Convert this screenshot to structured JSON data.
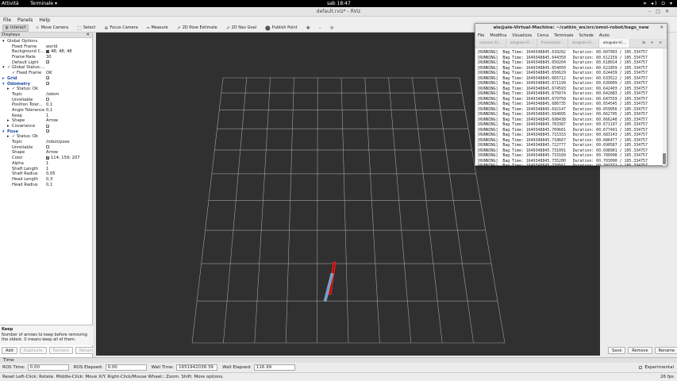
{
  "topbar": {
    "activities": "Attività",
    "app": "Terminale ▾",
    "clock": "sab 18:47",
    "tray": "⌗ ◂) ⏻ ▾"
  },
  "window": {
    "title": "default.rviz* - RViz"
  },
  "menu": [
    "File",
    "Panels",
    "Help"
  ],
  "toolbar": [
    {
      "icon": "✥",
      "label": "Interact",
      "active": true
    },
    {
      "icon": "✧",
      "label": "Move Camera",
      "active": false
    },
    {
      "icon": "⬚",
      "label": "Select",
      "active": false
    },
    {
      "icon": "⊕",
      "label": "Focus Camera",
      "active": false
    },
    {
      "icon": "═",
      "label": "Measure",
      "active": false
    },
    {
      "icon": "➚",
      "label": "2D Pose Estimate",
      "active": false
    },
    {
      "icon": "➚",
      "label": "2D Nav Goal",
      "active": false
    },
    {
      "icon": "⬤",
      "label": "Publish Point",
      "active": false
    },
    {
      "icon": "✚",
      "label": "",
      "active": false
    },
    {
      "icon": "–",
      "label": "",
      "active": false
    },
    {
      "icon": "✢",
      "label": "",
      "active": false
    }
  ],
  "displays": {
    "title": "Displays",
    "rows": [
      {
        "indent": 1,
        "arrow": "▾",
        "label": "Global Options",
        "value": "",
        "check": null,
        "color": "",
        "blue": false
      },
      {
        "indent": 3,
        "arrow": "",
        "label": "Fixed Frame",
        "value": "world",
        "check": null,
        "color": "",
        "blue": false
      },
      {
        "indent": 3,
        "arrow": "",
        "label": "Background C...",
        "value": "48; 48; 48",
        "check": null,
        "color": "#303030",
        "blue": false
      },
      {
        "indent": 3,
        "arrow": "",
        "label": "Frame Rate",
        "value": "30",
        "check": null,
        "color": "",
        "blue": false
      },
      {
        "indent": 3,
        "arrow": "",
        "label": "Default Light",
        "value": "",
        "check": true,
        "color": "",
        "blue": false
      },
      {
        "indent": 1,
        "arrow": "▾",
        "label": "✓ Global Status:...",
        "value": "",
        "check": null,
        "color": "",
        "blue": false
      },
      {
        "indent": 3,
        "arrow": "",
        "label": "✓ Fixed Frame",
        "value": "OK",
        "check": null,
        "color": "",
        "blue": false
      },
      {
        "indent": 1,
        "arrow": "▸",
        "label": "Grid",
        "value": "",
        "check": true,
        "color": "",
        "blue": true
      },
      {
        "indent": 1,
        "arrow": "▾",
        "label": "Odometry",
        "value": "",
        "check": true,
        "color": "",
        "blue": true
      },
      {
        "indent": 3,
        "arrow": "▸",
        "label": "✓ Status: Ok",
        "value": "",
        "check": null,
        "color": "",
        "blue": false
      },
      {
        "indent": 3,
        "arrow": "",
        "label": "Topic",
        "value": "/odom",
        "check": null,
        "color": "",
        "blue": false
      },
      {
        "indent": 3,
        "arrow": "",
        "label": "Unreliable",
        "value": "",
        "check": false,
        "color": "",
        "blue": false
      },
      {
        "indent": 3,
        "arrow": "",
        "label": "Position Toler...",
        "value": "0,1",
        "check": null,
        "color": "",
        "blue": false
      },
      {
        "indent": 3,
        "arrow": "",
        "label": "Angle Tolerance",
        "value": "0,1",
        "check": null,
        "color": "",
        "blue": false
      },
      {
        "indent": 3,
        "arrow": "",
        "label": "Keep",
        "value": "1",
        "check": null,
        "color": "",
        "blue": false
      },
      {
        "indent": 3,
        "arrow": "▸",
        "label": "Shape",
        "value": "Arrow",
        "check": null,
        "color": "",
        "blue": false
      },
      {
        "indent": 3,
        "arrow": "▸",
        "label": "Covariance",
        "value": "",
        "check": true,
        "color": "",
        "blue": false
      },
      {
        "indent": 1,
        "arrow": "▾",
        "label": "Pose",
        "value": "",
        "check": true,
        "color": "",
        "blue": true
      },
      {
        "indent": 3,
        "arrow": "▸",
        "label": "✓ Status: Ok",
        "value": "",
        "check": null,
        "color": "",
        "blue": false
      },
      {
        "indent": 3,
        "arrow": "",
        "label": "Topic",
        "value": "/robot/pose",
        "check": null,
        "color": "",
        "blue": false
      },
      {
        "indent": 3,
        "arrow": "",
        "label": "Unreliable",
        "value": "",
        "check": false,
        "color": "",
        "blue": false
      },
      {
        "indent": 3,
        "arrow": "",
        "label": "Shape",
        "value": "Arrow",
        "check": null,
        "color": "",
        "blue": false
      },
      {
        "indent": 3,
        "arrow": "",
        "label": "Color",
        "value": "114; 159; 207",
        "check": null,
        "color": "#729fcf",
        "blue": false
      },
      {
        "indent": 3,
        "arrow": "",
        "label": "Alpha",
        "value": "1",
        "check": null,
        "color": "",
        "blue": false
      },
      {
        "indent": 3,
        "arrow": "",
        "label": "Shaft Length",
        "value": "1",
        "check": null,
        "color": "",
        "blue": false
      },
      {
        "indent": 3,
        "arrow": "",
        "label": "Shaft Radius",
        "value": "0,05",
        "check": null,
        "color": "",
        "blue": false
      },
      {
        "indent": 3,
        "arrow": "",
        "label": "Head Length",
        "value": "0,3",
        "check": null,
        "color": "",
        "blue": false
      },
      {
        "indent": 3,
        "arrow": "",
        "label": "Head Radius",
        "value": "0,1",
        "check": null,
        "color": "",
        "blue": false
      }
    ]
  },
  "help": {
    "title": "Keep",
    "text": "Number of arrows to keep before removing the oldest. 0 means keep all of them."
  },
  "panel_buttons": {
    "add": "Add",
    "duplicate": "Duplicate",
    "remove": "Remove",
    "rename": "Rename"
  },
  "views_buttons": {
    "save": "Save",
    "remove": "Remove",
    "rename": "Rename"
  },
  "time": {
    "title": "Time",
    "ros_time_label": "ROS Time:",
    "ros_time": "0.00",
    "ros_elapsed_label": "ROS Elapsed:",
    "ros_elapsed": "0.00",
    "wall_time_label": "Wall Time:",
    "wall_time": "1651942038.39",
    "wall_elapsed_label": "Wall Elapsed:",
    "wall_elapsed": "116.99",
    "experimental": "Experimental"
  },
  "status": {
    "text": "Reset   Left-Click: Rotate. Middle-Click: Move X/Y. Right-Click/Mouse Wheel:: Zoom. Shift: More options.",
    "fps": "26 fps"
  },
  "terminal": {
    "title": "ale@ale-Virtual-Machine: ~/catkin_ws/src/omni-robot/bags_new",
    "menu": [
      "File",
      "Modifica",
      "Visualizza",
      "Cerca",
      "Terminale",
      "Schede",
      "Aiuto"
    ],
    "tabs": [
      "roscore ht...",
      "ale@ale-Vi...",
      "/home/ale/...",
      "ale@ale-Vi...",
      "ale@ale-Vi..."
    ],
    "tools": "⊞ ▾ ≡",
    "lines": [
      "[RUNNING]  Bag Time: 1649348845.639282   Duration: 60.607093 / 105.334757",
      "[RUNNING]  Bag Time: 1649348845.644350   Duration: 60.612159 / 105.334757",
      "[RUNNING]  Bag Time: 1649348845.650204   Duration: 60.618014 / 105.334757",
      "[RUNNING]  Bag Time: 1649348845.654050   Duration: 60.621859 / 105.334757",
      "[RUNNING]  Bag Time: 1649348845.656629   Duration: 60.624439 / 105.334757",
      "[RUNNING]  Bag Time: 1649348845.665712   Duration: 60.633522 / 105.334757",
      "[RUNNING]  Bag Time: 1649348845.671199   Duration: 60.639009 / 105.334757",
      "[RUNNING]  Bag Time: 1649348845.674593   Duration: 60.642403 / 105.334757",
      "[RUNNING]  Bag Time: 1649348845.675074   Duration: 60.642883 / 105.334757",
      "[RUNNING]  Bag Time: 1649348845.679750   Duration: 60.647559 / 105.334757",
      "[RUNNING]  Bag Time: 1649348845.686735   Duration: 60.654545 / 105.334757",
      "[RUNNING]  Bag Time: 1649348845.692147   Duration: 60.659956 / 105.334757",
      "[RUNNING]  Bag Time: 1649348845.694895   Duration: 60.662705 / 105.334757",
      "[RUNNING]  Bag Time: 1649348845.698438   Duration: 60.666248 / 105.334757",
      "[RUNNING]  Bag Time: 1649348845.703387   Duration: 60.671197 / 105.334757",
      "[RUNNING]  Bag Time: 1649348845.709681   Duration: 60.677491 / 105.334757",
      "[RUNNING]  Bag Time: 1649348845.715333   Duration: 60.683143 / 105.334757",
      "[RUNNING]  Bag Time: 1649348845.718667   Duration: 60.686477 / 105.334757",
      "[RUNNING]  Bag Time: 1649348845.722777   Duration: 60.690587 / 105.334757",
      "[RUNNING]  Bag Time: 1649348845.731091   Duration: 60.698901 / 105.334757",
      "[RUNNING]  Bag Time: 1649348845.733189   Duration: 60.700998 / 105.334757",
      "[RUNNING]  Bag Time: 1649348845.735280   Duration: 60.703090 / 105.334757",
      "[RUNNING]  Bag Time: 1649348845.739561   Duration: 60.707371 / 105.334757"
    ]
  },
  "colors": {
    "viewport_bg": "#303030",
    "grid": "#a0a0a0",
    "odometry_arrow": "#cc0000",
    "pose_arrow": "#729fcf"
  }
}
